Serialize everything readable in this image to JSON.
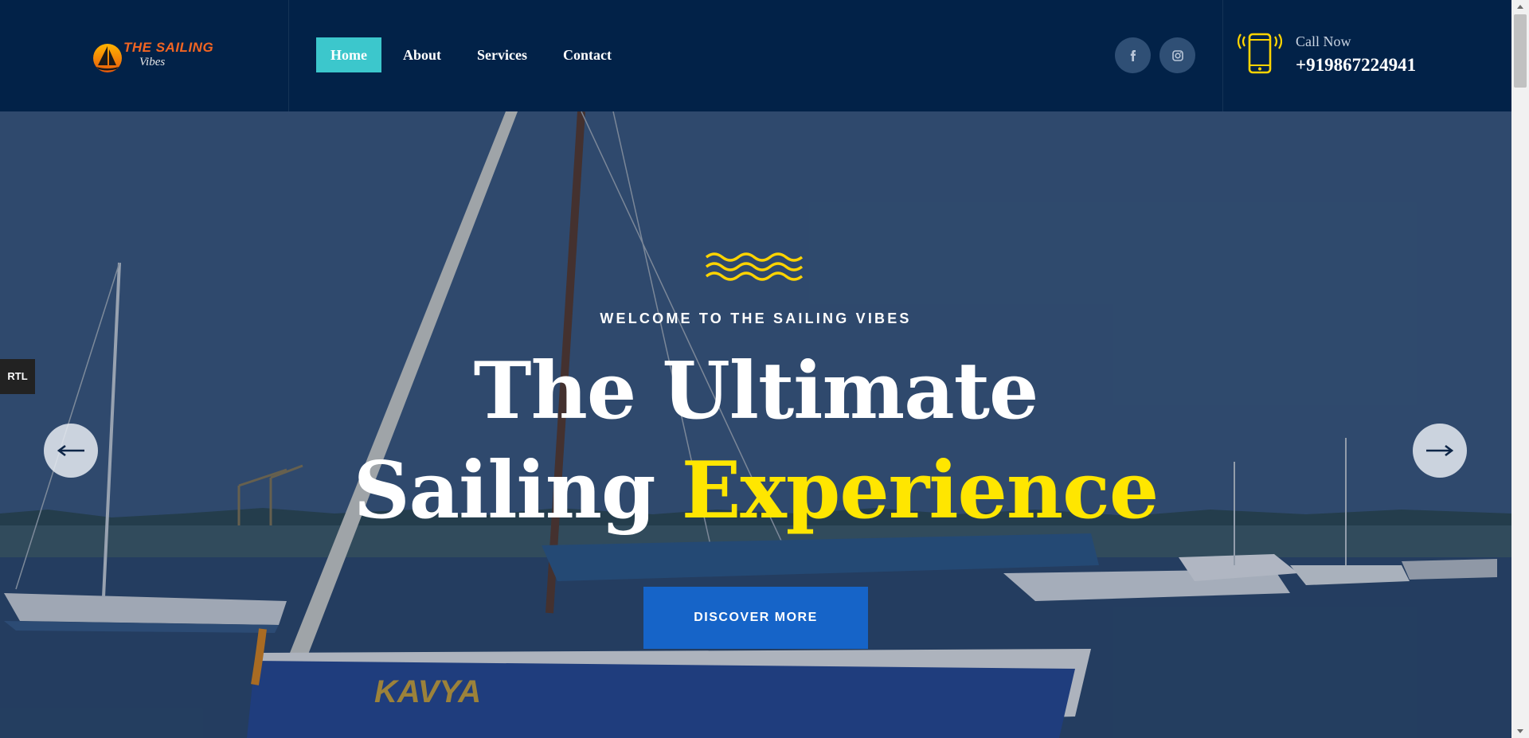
{
  "brand": {
    "logo_line1": "THE SAILING",
    "logo_line2": "Vibes"
  },
  "nav": {
    "items": [
      {
        "label": "Home",
        "active": true
      },
      {
        "label": "About",
        "active": false
      },
      {
        "label": "Services",
        "active": false
      },
      {
        "label": "Contact",
        "active": false
      }
    ]
  },
  "social": [
    {
      "icon": "facebook-icon",
      "glyph": "f"
    },
    {
      "icon": "instagram-icon"
    }
  ],
  "contact": {
    "icon": "phone-icon",
    "label": "Call Now",
    "number": "+919867224941"
  },
  "hero": {
    "icon": "waves-icon",
    "welcome": "WELCOME TO THE SAILING VIBES",
    "headline_line1": "The Ultimate",
    "headline_line2_plain": "Sailing",
    "headline_line2_accent": "Experience",
    "cta_label": "DISCOVER MORE",
    "boat_name": "KAVYA",
    "prev_icon": "arrow-left-icon",
    "next_icon": "arrow-right-icon"
  },
  "rtl_toggle": {
    "label": "RTL"
  },
  "colors": {
    "header_bg": "#022248",
    "nav_active": "#3cc7cc",
    "accent_yellow": "#ffe600",
    "cta_blue": "#1664c8"
  }
}
